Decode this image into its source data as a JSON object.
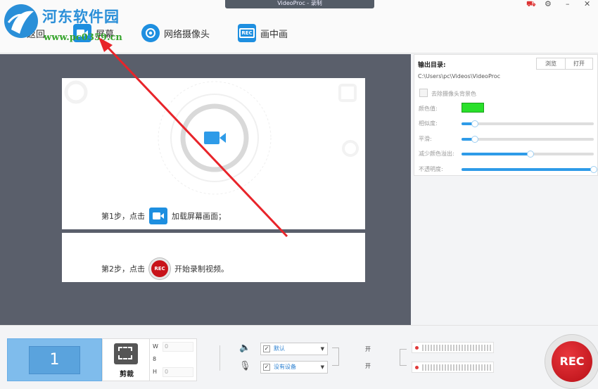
{
  "window": {
    "title": "VideoProc - 录制"
  },
  "watermark": {
    "title": "河东软件园",
    "url": "www.pc0359.cn"
  },
  "toolbar": {
    "items": [
      {
        "label": "屏幕",
        "icon": "screen-record-icon"
      },
      {
        "label": "网络摄像头",
        "icon": "webcam-icon"
      },
      {
        "label": "画中画",
        "icon": "pip-rec-icon"
      }
    ],
    "partial_label": "返回",
    "rec_badge": "REC"
  },
  "stage": {
    "step1": {
      "prefix": "第1步，点击",
      "suffix": "加载屏幕画面；"
    },
    "step2": {
      "prefix": "第2步，点击",
      "suffix": "开始录制视频。",
      "rec_label": "REC"
    }
  },
  "panel": {
    "output_label": "输出目录:",
    "browse_label": "浏览",
    "open_label": "打开",
    "path": "C:\\Users\\pc\\Videos\\VideoProc",
    "remove_bg_label": "去除摄像头背景色",
    "color_key_label": "颜色值:",
    "color_key": "#29e02a",
    "sliders": [
      {
        "label": "相似度:",
        "value": 0.1
      },
      {
        "label": "平滑:",
        "value": 0.1
      },
      {
        "label": "减少颜色溢出:",
        "value": 0.52
      },
      {
        "label": "不透明度:",
        "value": 1.0
      }
    ]
  },
  "bottom": {
    "screen_number": "1",
    "crop_label": "剪裁",
    "dims": {
      "w_label": "W",
      "w_value": "0",
      "lock_label": "8",
      "h_label": "H",
      "h_value": "0"
    },
    "speaker": {
      "device": "默认",
      "state": "开"
    },
    "mic": {
      "device": "没有设备",
      "state": "开"
    },
    "rec_label": "REC"
  }
}
